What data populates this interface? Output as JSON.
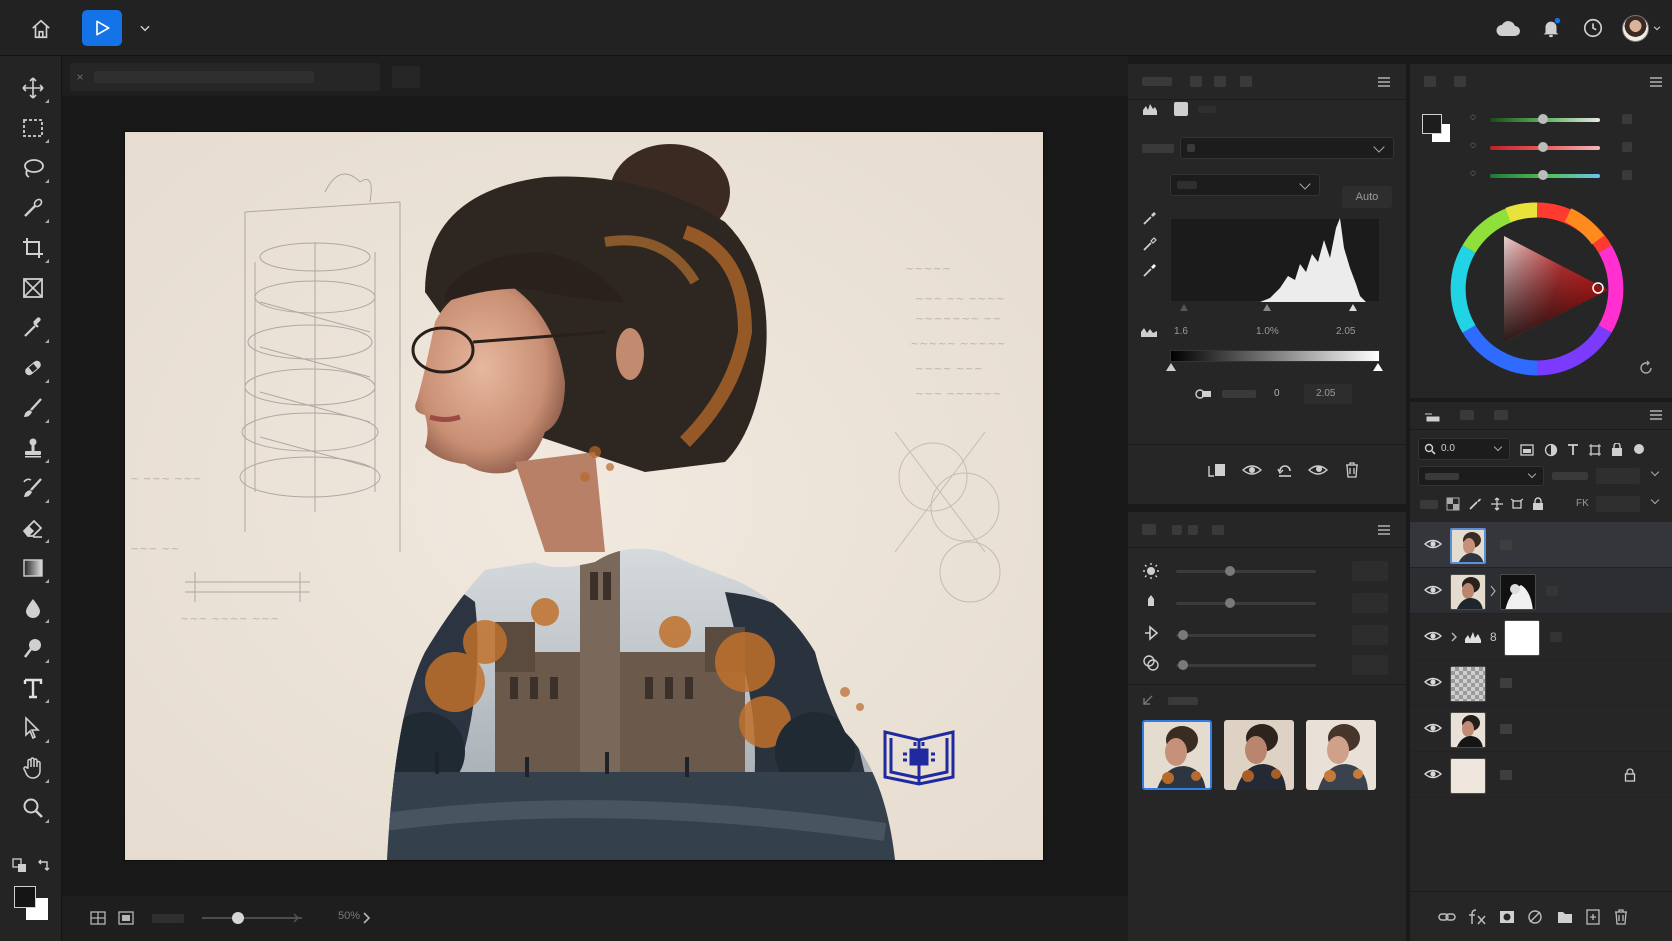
{
  "app": {
    "brand_color": "#1473e6",
    "top_icons": [
      "home-icon",
      "play-icon",
      "chevron-down-icon",
      "cloud-icon",
      "bell-icon",
      "clock-icon",
      "avatar"
    ]
  },
  "toolbar": {
    "tools": [
      "move-icon",
      "marquee-icon",
      "lasso-icon",
      "quick-select-icon",
      "crop-icon",
      "frame-icon",
      "eyedropper-icon",
      "healing-icon",
      "brush-icon",
      "stamp-icon",
      "history-brush-icon",
      "eraser-icon",
      "gradient-icon",
      "blur-icon",
      "dodge-icon",
      "type-icon",
      "path-select-icon",
      "hand-icon",
      "zoom-icon"
    ]
  },
  "document": {
    "close_glyph": "×",
    "zoom_label": "50%"
  },
  "levels": {
    "auto_label": "Auto",
    "input_low": "1.6",
    "input_mid": "1.0%",
    "input_high": "2.05",
    "output_low": "0",
    "output_high": "2.05"
  },
  "layers": {
    "search_value": "0.0",
    "fx_label": "FK",
    "group_count": "8"
  }
}
